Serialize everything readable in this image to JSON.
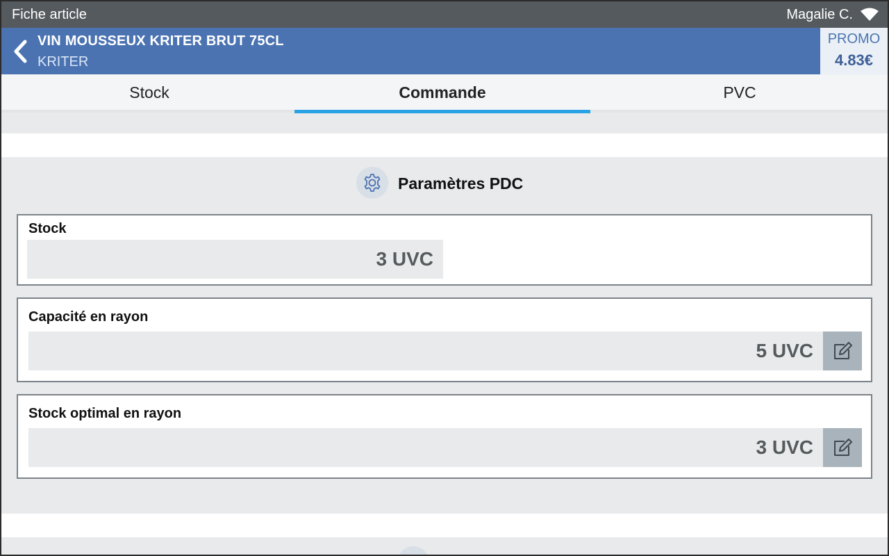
{
  "status_bar": {
    "title": "Fiche article",
    "user": "Magalie C.",
    "wifi_icon": "wifi-icon"
  },
  "product": {
    "name": "VIN MOUSSEUX KRITER BRUT 75CL",
    "brand": "KRITER",
    "promo_label": "PROMO",
    "promo_price": "4.83€"
  },
  "tabs": [
    {
      "label": "Stock",
      "active": false
    },
    {
      "label": "Commande",
      "active": true
    },
    {
      "label": "PVC",
      "active": false
    }
  ],
  "section": {
    "title": "Paramètres PDC",
    "icon": "gear-icon"
  },
  "cards": [
    {
      "label": "Stock",
      "value": "3 UVC",
      "editable": false
    },
    {
      "label": "Capacité en rayon",
      "value": "5 UVC",
      "editable": true
    },
    {
      "label": "Stock optimal en rayon",
      "value": "3 UVC",
      "editable": true
    }
  ],
  "colors": {
    "header": "#4b73b2",
    "status_bar": "#555a5e",
    "tab_active_underline": "#29a3e6",
    "edit_button": "#a8b3bb"
  }
}
